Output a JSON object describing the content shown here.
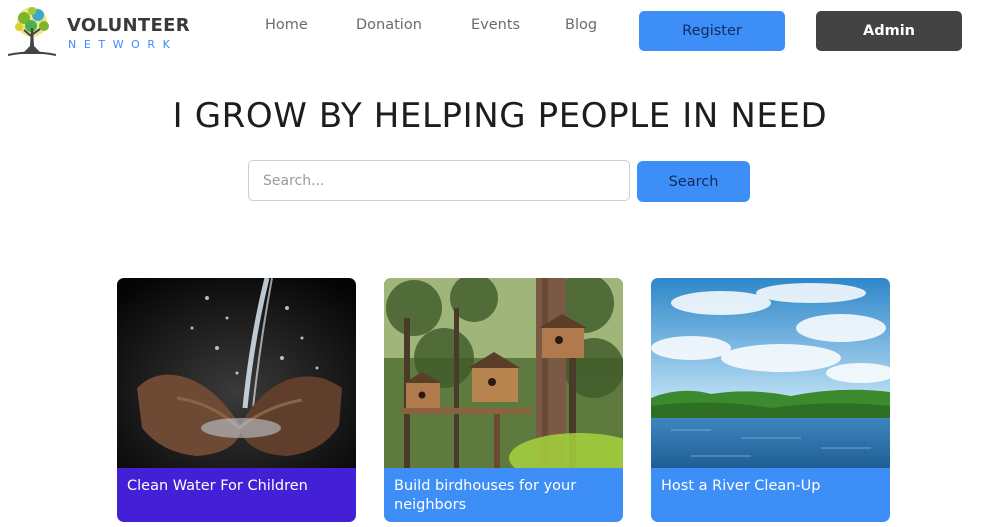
{
  "brand": {
    "title": "VOLUNTEER",
    "subtitle": "NETWORK"
  },
  "nav": {
    "items": [
      "Home",
      "Donation",
      "Events",
      "Blog"
    ],
    "register_label": "Register",
    "admin_label": "Admin"
  },
  "hero": {
    "title": "I GROW BY HELPING PEOPLE IN NEED"
  },
  "search": {
    "placeholder": "Search...",
    "value": "",
    "button_label": "Search"
  },
  "events": [
    {
      "title": "Clean Water For Children",
      "image": "water-hands-image",
      "caption_color": "#4320d6"
    },
    {
      "title": "Build birdhouses for your neighbors",
      "image": "birdhouses-image",
      "caption_color": "#3e8ef7"
    },
    {
      "title": "Host a River Clean-Up",
      "image": "river-image",
      "caption_color": "#3e8ef7"
    }
  ],
  "colors": {
    "accent": "#3e8ef7",
    "accent_text": "#102a5e",
    "admin_bg": "#434343",
    "card_purple": "#4320d6",
    "logo_green": "#7cb52c",
    "logo_yellow": "#e0d12a"
  }
}
